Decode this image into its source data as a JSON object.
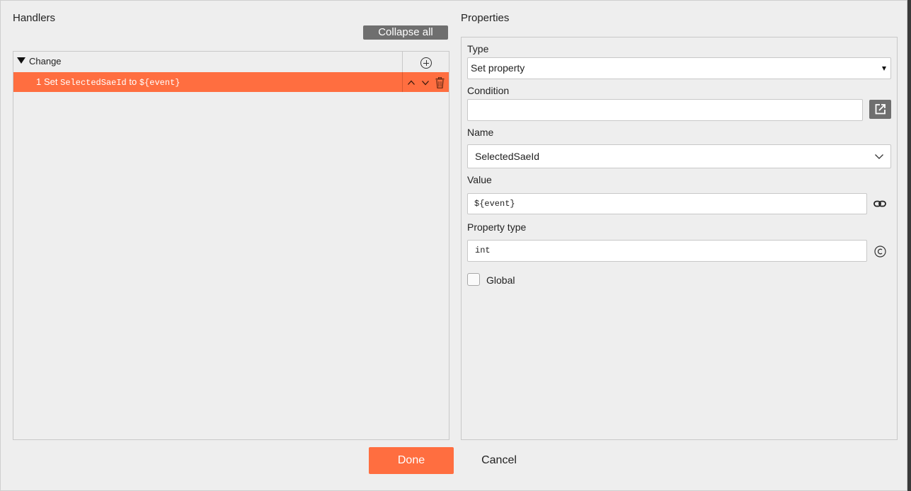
{
  "handlers": {
    "title": "Handlers",
    "collapse_all_label": "Collapse all",
    "group": {
      "label": "Change",
      "add_icon": "plus-circle-icon",
      "actions": [
        {
          "index": "1",
          "verb": "Set",
          "property": "SelectedSaeId",
          "connector": "to",
          "value": "${event}"
        }
      ]
    }
  },
  "properties": {
    "title": "Properties",
    "type": {
      "label": "Type",
      "value": "Set property"
    },
    "condition": {
      "label": "Condition",
      "value": "",
      "button_icon": "open-external-icon"
    },
    "name": {
      "label": "Name",
      "value": "SelectedSaeId"
    },
    "value": {
      "label": "Value",
      "value": "${event}",
      "icon": "link-icon"
    },
    "property_type": {
      "label": "Property type",
      "value": "int",
      "icon": "copyright-icon"
    },
    "global": {
      "label": "Global",
      "checked": false
    }
  },
  "footer": {
    "done_label": "Done",
    "cancel_label": "Cancel"
  },
  "colors": {
    "accent": "#ff6e40",
    "button_gray": "#6f6f6f",
    "background": "#eeeeee"
  }
}
